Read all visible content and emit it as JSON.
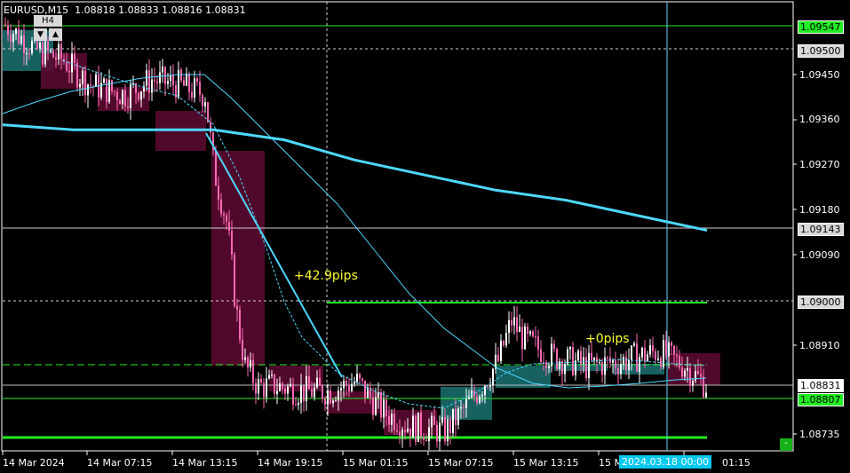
{
  "header": {
    "symbol_timeframe": "EURUSD,M15",
    "ohlc": "1.08818 1.08833 1.08816 1.08831",
    "tf_button": "H4",
    "arrow_down": "▼",
    "arrow_up": "▲"
  },
  "price_axis": {
    "labels": [
      "1.09450",
      "1.09360",
      "1.09270",
      "1.09180",
      "1.09090",
      "1.08910",
      "1.08735"
    ],
    "boxed": {
      "green_top": "1.09547",
      "level_1": "1.09500",
      "level_2": "1.09143",
      "level_3": "1.09000",
      "bid": "1.08831",
      "green_bottom": "1.08807"
    }
  },
  "time_axis": {
    "labels": [
      "14 Mar 2024",
      "14 Mar 07:15",
      "14 Mar 13:15",
      "14 Mar 19:15",
      "15 Mar 01:15",
      "15 Mar 07:15",
      "15 Mar 13:15",
      "15 M",
      "01:15"
    ],
    "crosshair_date": "2024.03.18 00:00"
  },
  "annotations": {
    "pips_left": "+42.9pips",
    "pips_right": "+0pips"
  },
  "corner_button": "-",
  "colors": {
    "background": "#000000",
    "bull": "#ffffff",
    "bear": "#ff69b4",
    "h4_bear_box": "#5a0a30",
    "h4_bull_box": "#1a6b6b",
    "ma": "#4dd8ff",
    "green_level": "#22ee22",
    "annotation": "#ffff33"
  },
  "chart_data": {
    "type": "candlestick",
    "symbol": "EURUSD",
    "timeframe": "M15",
    "ylim": [
      1.087,
      1.0962
    ],
    "price_levels": [
      1.09547,
      1.095,
      1.09143,
      1.09,
      1.08831,
      1.08807,
      1.0873
    ],
    "moving_average_slow": [
      1.0935,
      1.0934,
      1.0934,
      1.0934,
      1.0932,
      1.0928,
      1.0925,
      1.0922,
      1.092,
      1.0917,
      1.0914
    ],
    "price_path": [
      1.0953,
      1.0948,
      1.0943,
      1.0941,
      1.0944,
      1.0942,
      1.0927,
      1.0898,
      1.0882,
      1.0885,
      1.0878,
      1.0875,
      1.0874,
      1.0885,
      1.0895,
      1.0889,
      1.0888,
      1.0887,
      1.0886,
      1.0883
    ]
  }
}
